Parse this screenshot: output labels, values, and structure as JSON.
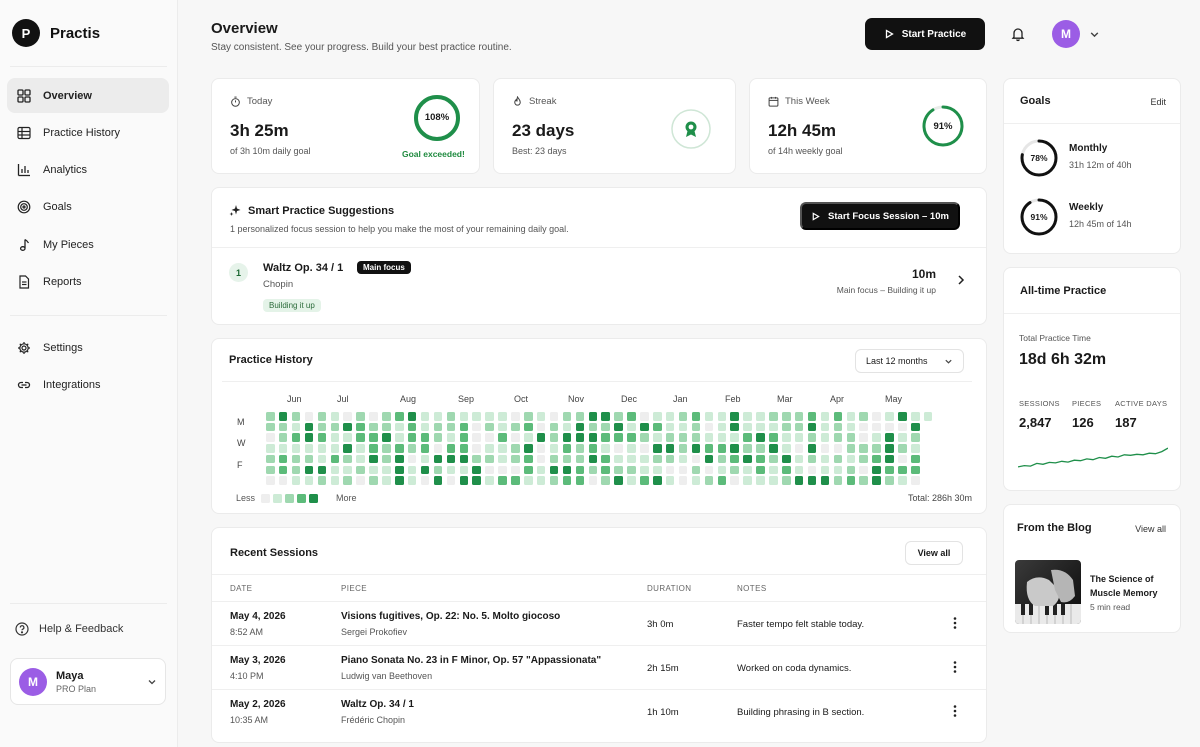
{
  "brand": {
    "logo_letter": "P",
    "name": "Practis"
  },
  "sidebar": {
    "items": [
      {
        "label": "Overview",
        "icon": "grid-icon",
        "active": true
      },
      {
        "label": "Practice History",
        "icon": "table-icon"
      },
      {
        "label": "Analytics",
        "icon": "bar-chart-icon"
      },
      {
        "label": "Goals",
        "icon": "target-icon"
      },
      {
        "label": "My Pieces",
        "icon": "music-note-icon"
      },
      {
        "label": "Reports",
        "icon": "document-icon"
      }
    ],
    "items2": [
      {
        "label": "Settings",
        "icon": "gear-icon"
      },
      {
        "label": "Integrations",
        "icon": "link-icon"
      }
    ],
    "help": "Help & Feedback",
    "user": {
      "initial": "M",
      "name": "Maya",
      "plan": "PRO Plan"
    }
  },
  "header": {
    "title": "Overview",
    "subtitle": "Stay consistent. See your progress. Build your best practice routine.",
    "start_label": "Start Practice",
    "avatar_initial": "M"
  },
  "stats": {
    "today": {
      "label": "Today",
      "value": "3h 25m",
      "sub": "of 3h 10m daily goal",
      "ring_text": "108%",
      "progress": 1.0,
      "note": "Goal exceeded!"
    },
    "streak": {
      "label": "Streak",
      "value": "23 days",
      "sub": "Best: 23 days"
    },
    "week": {
      "label": "This Week",
      "value": "12h 45m",
      "sub": "of 14h weekly goal",
      "ring_text": "91%",
      "progress": 0.91
    }
  },
  "suggestions": {
    "title": "Smart Practice Suggestions",
    "subtitle": "1 personalized focus session to help you make the most of your remaining daily goal.",
    "button": "Start Focus Session – 10m",
    "item": {
      "index": "1",
      "title": "Waltz Op. 34 / 1",
      "badge": "Main focus",
      "composer": "Chopin",
      "tag": "Building it up",
      "duration": "10m",
      "meta": "Main focus – Building it up"
    }
  },
  "history": {
    "title": "Practice History",
    "range": "Last 12 months",
    "months": [
      "Jun",
      "Jul",
      "Aug",
      "Sep",
      "Oct",
      "Nov",
      "Dec",
      "Jan",
      "Feb",
      "Mar",
      "Apr",
      "May"
    ],
    "days": [
      "M",
      "W",
      "F"
    ],
    "legend_less": "Less",
    "legend_more": "More",
    "total": "Total: 286h 30m",
    "colors": [
      "#eeeeee",
      "#cdebd6",
      "#9fd8b0",
      "#5cbb7a",
      "#1f8f4a"
    ]
  },
  "sessions": {
    "title": "Recent Sessions",
    "view_all": "View all",
    "columns": [
      "DATE",
      "PIECE",
      "DURATION",
      "NOTES"
    ],
    "rows": [
      {
        "date": "May 4, 2026",
        "time": "8:52 AM",
        "piece": "Visions fugitives, Op. 22: No. 5. Molto giocoso",
        "composer": "Sergei Prokofiev",
        "duration": "3h 0m",
        "note": "Faster tempo felt stable today."
      },
      {
        "date": "May 3, 2026",
        "time": "4:10 PM",
        "piece": "Piano Sonata No. 23 in F Minor, Op. 57 \"Appassionata\"",
        "composer": "Ludwig van Beethoven",
        "duration": "2h 15m",
        "note": "Worked on coda dynamics."
      },
      {
        "date": "May 2, 2026",
        "time": "10:35 AM",
        "piece": "Waltz Op. 34 / 1",
        "composer": "Frédéric Chopin",
        "duration": "1h 10m",
        "note": "Building phrasing in B section."
      }
    ]
  },
  "goals": {
    "title": "Goals",
    "edit": "Edit",
    "items": [
      {
        "ring_text": "78%",
        "progress": 0.78,
        "title": "Monthly",
        "sub": "31h 12m of 40h"
      },
      {
        "ring_text": "91%",
        "progress": 0.91,
        "title": "Weekly",
        "sub": "12h 45m of 14h"
      }
    ]
  },
  "alltime": {
    "title": "All-time Practice",
    "total_label": "Total Practice Time",
    "total_value": "18d 6h 32m",
    "metrics": [
      {
        "label": "SESSIONS",
        "value": "2,847"
      },
      {
        "label": "PIECES",
        "value": "126"
      },
      {
        "label": "ACTIVE DAYS",
        "value": "187"
      }
    ],
    "trend": [
      0.15,
      0.2,
      0.18,
      0.28,
      0.25,
      0.32,
      0.3,
      0.36,
      0.33,
      0.4,
      0.38,
      0.45,
      0.42,
      0.5,
      0.47,
      0.55,
      0.52,
      0.6,
      0.58,
      0.62,
      0.6,
      0.66,
      0.64,
      0.72,
      0.85
    ]
  },
  "blog": {
    "title": "From the Blog",
    "view_all": "View all",
    "post_title": "The Science of Muscle Memory",
    "post_meta": "5 min read"
  }
}
